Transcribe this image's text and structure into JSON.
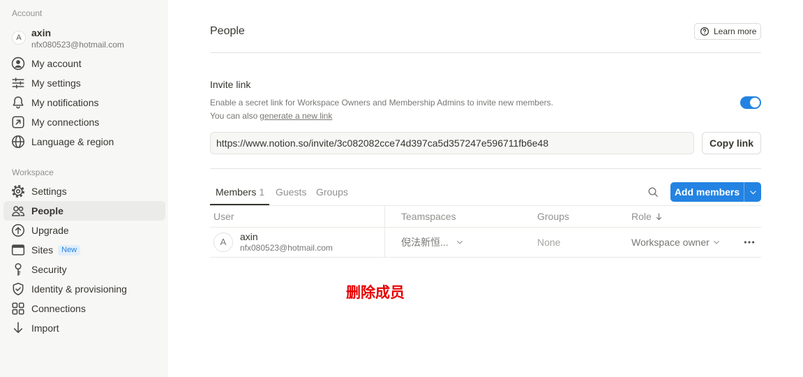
{
  "colors": {
    "accent": "#2383e2",
    "annotation": "#e60000",
    "sidebar_background": "#f7f7f5"
  },
  "sidebar": {
    "account_header": "Account",
    "user": {
      "avatar_letter": "A",
      "name": "axin",
      "email": "nfx080523@hotmail.com"
    },
    "account_items": [
      {
        "label": "My account",
        "icon": "user-circle-icon"
      },
      {
        "label": "My settings",
        "icon": "sliders-icon"
      },
      {
        "label": "My notifications",
        "icon": "bell-icon"
      },
      {
        "label": "My connections",
        "icon": "arrow-up-right-square-icon"
      },
      {
        "label": "Language & region",
        "icon": "globe-icon"
      }
    ],
    "workspace_header": "Workspace",
    "workspace_items": [
      {
        "label": "Settings",
        "icon": "gear-icon",
        "selected": false
      },
      {
        "label": "People",
        "icon": "people-icon",
        "selected": true
      },
      {
        "label": "Upgrade",
        "icon": "arrow-up-circle-icon",
        "selected": false
      },
      {
        "label": "Sites",
        "icon": "browser-window-icon",
        "badge": "New",
        "selected": false
      },
      {
        "label": "Security",
        "icon": "key-icon",
        "selected": false
      },
      {
        "label": "Identity & provisioning",
        "icon": "shield-check-icon",
        "selected": false
      },
      {
        "label": "Connections",
        "icon": "grid-icon",
        "selected": false
      },
      {
        "label": "Import",
        "icon": "arrow-down-icon",
        "selected": false
      }
    ]
  },
  "main": {
    "title": "People",
    "learn_more": {
      "label": "Learn more",
      "icon": "question-circle-icon"
    },
    "invite_link": {
      "heading": "Invite link",
      "description": "Enable a secret link for Workspace Owners and Membership Admins to invite new members.",
      "generate_prefix": "You can also",
      "generate_link": "generate a new link",
      "enabled": true,
      "url": "https://www.notion.so/invite/3c082082cce74d397ca5d357247e596711fb6e48",
      "copy_button": "Copy link"
    },
    "tabs": [
      {
        "label": "Members",
        "count": "1",
        "active": true
      },
      {
        "label": "Guests",
        "active": false
      },
      {
        "label": "Groups",
        "active": false
      }
    ],
    "search_icon": "search-icon",
    "add_members": {
      "label": "Add members",
      "dropdown_icon": "chevron-down-icon"
    },
    "table": {
      "columns": [
        {
          "label": "User"
        },
        {
          "label": "Teamspaces"
        },
        {
          "label": "Groups"
        },
        {
          "label": "Role",
          "sort_icon": "arrow-down-icon"
        }
      ],
      "rows": [
        {
          "avatar_letter": "A",
          "name": "axin",
          "email": "nfx080523@hotmail.com",
          "teamspaces": "倪法新恒...",
          "groups": "None",
          "role": "Workspace owner",
          "more_icon": "more-horizontal-icon"
        }
      ]
    }
  },
  "annotation": {
    "text": "删除成员"
  }
}
